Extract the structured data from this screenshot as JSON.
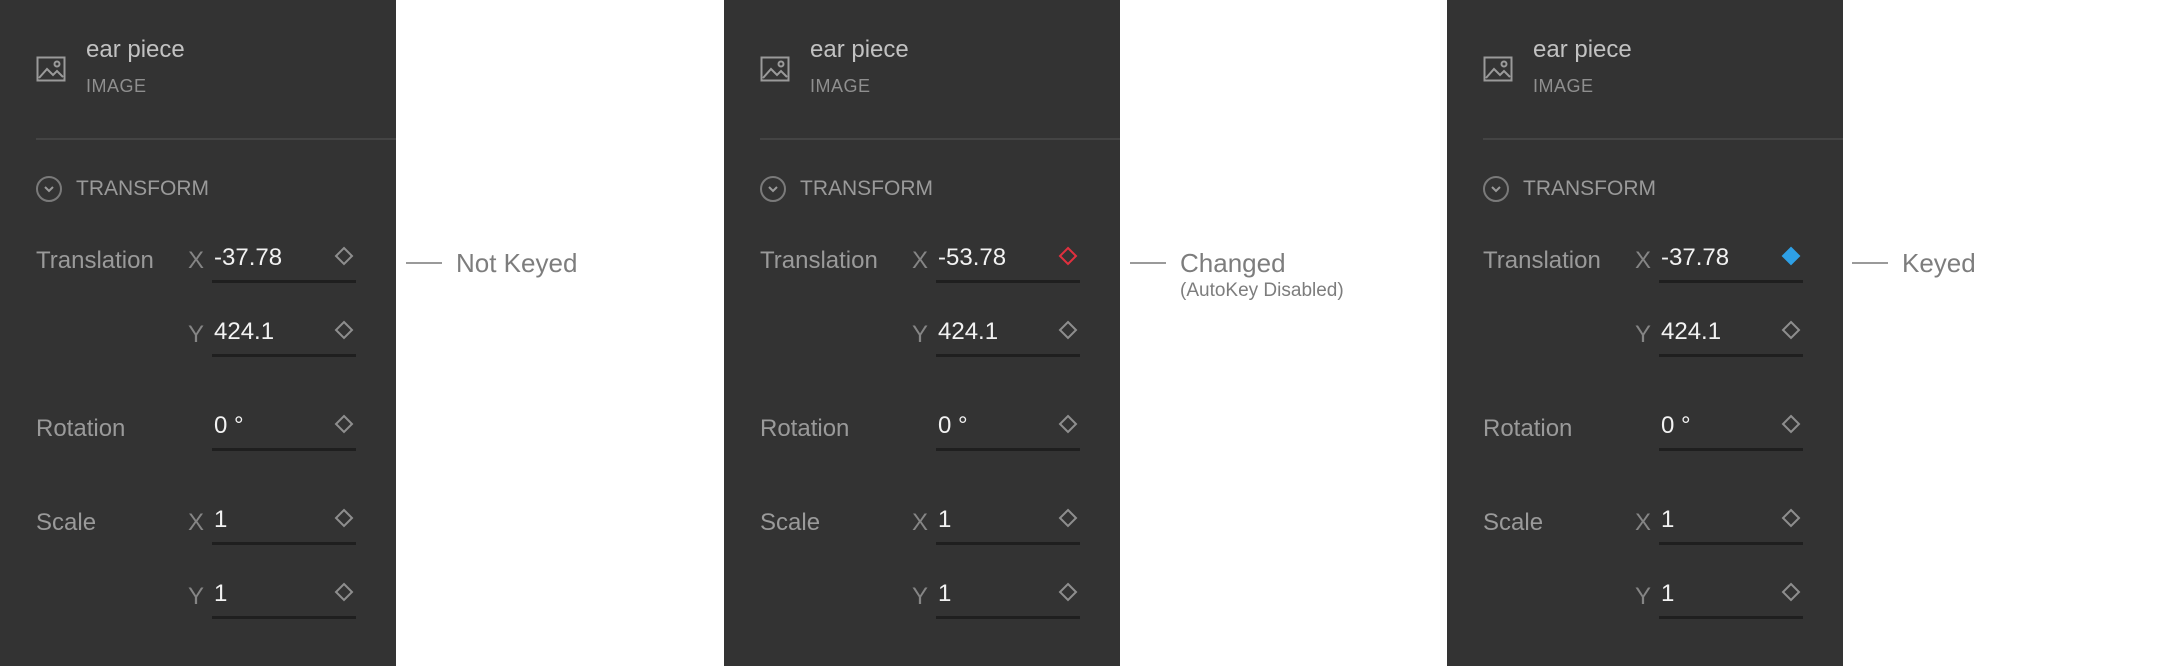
{
  "colors": {
    "panel_bg": "#333333",
    "key_outline": "#8e8e8e",
    "key_changed": "#e0303e",
    "key_keyed": "#2ea0e6"
  },
  "panels": [
    {
      "object_name": "ear piece",
      "object_type": "IMAGE",
      "section": "TRANSFORM",
      "translation_label": "Translation",
      "translation_x_axis": "X",
      "translation_x": "-37.78",
      "translation_x_key_state": "not-keyed",
      "translation_y_axis": "Y",
      "translation_y": "424.1",
      "rotation_label": "Rotation",
      "rotation": "0 °",
      "scale_label": "Scale",
      "scale_x_axis": "X",
      "scale_x": "1",
      "scale_y_axis": "Y",
      "scale_y": "1",
      "note": "Not Keyed",
      "note_sub": ""
    },
    {
      "object_name": "ear piece",
      "object_type": "IMAGE",
      "section": "TRANSFORM",
      "translation_label": "Translation",
      "translation_x_axis": "X",
      "translation_x": "-53.78",
      "translation_x_key_state": "changed",
      "translation_y_axis": "Y",
      "translation_y": "424.1",
      "rotation_label": "Rotation",
      "rotation": "0 °",
      "scale_label": "Scale",
      "scale_x_axis": "X",
      "scale_x": "1",
      "scale_y_axis": "Y",
      "scale_y": "1",
      "note": "Changed",
      "note_sub": "(AutoKey Disabled)"
    },
    {
      "object_name": "ear piece",
      "object_type": "IMAGE",
      "section": "TRANSFORM",
      "translation_label": "Translation",
      "translation_x_axis": "X",
      "translation_x": "-37.78",
      "translation_x_key_state": "keyed",
      "translation_y_axis": "Y",
      "translation_y": "424.1",
      "rotation_label": "Rotation",
      "rotation": "0 °",
      "scale_label": "Scale",
      "scale_x_axis": "X",
      "scale_x": "1",
      "scale_y_axis": "Y",
      "scale_y": "1",
      "note": "Keyed",
      "note_sub": ""
    }
  ]
}
